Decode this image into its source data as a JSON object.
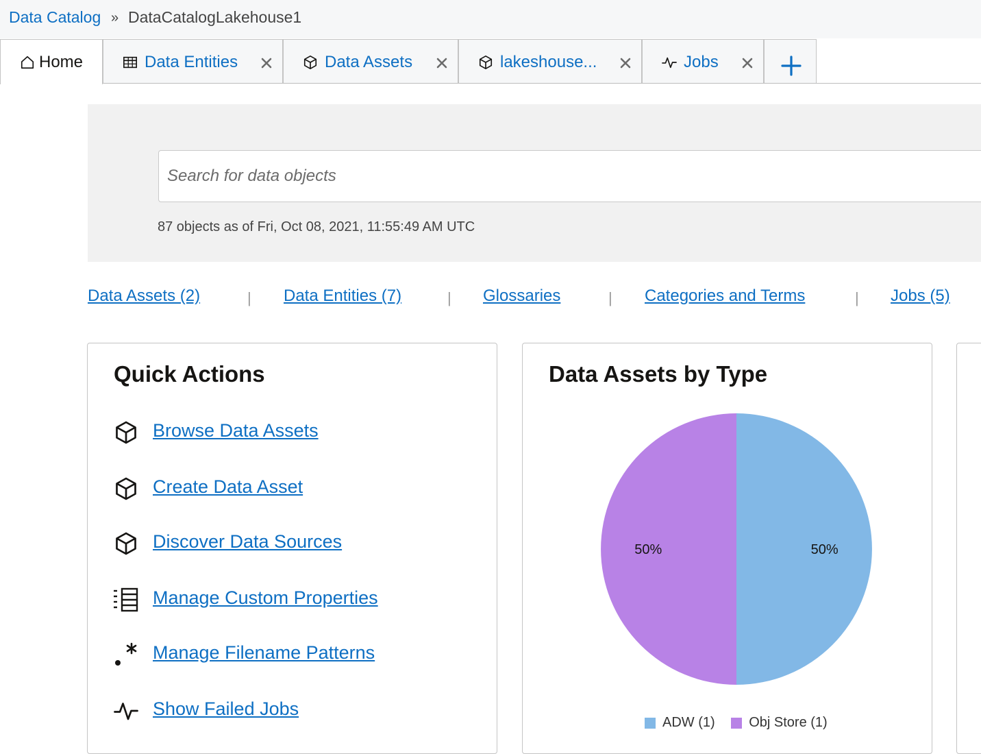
{
  "breadcrumb": {
    "root": "Data Catalog",
    "separator": "»",
    "current": "DataCatalogLakehouse1"
  },
  "tabs": [
    {
      "label": "Home",
      "icon": "home-icon",
      "active": true,
      "closable": false
    },
    {
      "label": "Data Entities",
      "icon": "table-icon",
      "active": false,
      "closable": true
    },
    {
      "label": "Data Assets",
      "icon": "cube-icon",
      "active": false,
      "closable": true
    },
    {
      "label": "lakeshouse...",
      "icon": "cube-icon",
      "active": false,
      "closable": true
    },
    {
      "label": "Jobs",
      "icon": "activity-icon",
      "active": false,
      "closable": true
    }
  ],
  "add_tab": {
    "icon": "plus-icon"
  },
  "search": {
    "placeholder": "Search for data objects",
    "value": "",
    "count_text": "87 objects as of Fri, Oct 08, 2021, 11:55:49 AM UTC"
  },
  "quick_links": [
    {
      "label": "Data Assets (2)"
    },
    {
      "label": "Data Entities (7)"
    },
    {
      "label": "Glossaries"
    },
    {
      "label": "Categories and Terms"
    },
    {
      "label": "Jobs (5)"
    }
  ],
  "quick_actions": {
    "title": "Quick Actions",
    "items": [
      {
        "label": "Browse Data Assets",
        "icon": "cube-icon"
      },
      {
        "label": "Create Data Asset",
        "icon": "cube-icon"
      },
      {
        "label": "Discover Data Sources",
        "icon": "cube-icon"
      },
      {
        "label": "Manage Custom Properties",
        "icon": "list-icon"
      },
      {
        "label": "Manage Filename Patterns",
        "icon": "regex-icon"
      },
      {
        "label": "Show Failed Jobs",
        "icon": "activity-icon"
      }
    ]
  },
  "assets_card": {
    "title": "Data Assets by Type"
  },
  "colors": {
    "link": "#0e6fc3",
    "adw": "#82b8e6",
    "obj_store": "#b882e6"
  },
  "chart_data": {
    "type": "pie",
    "title": "Data Assets by Type",
    "slices": [
      {
        "label": "ADW (1)",
        "value": 1,
        "percent_label": "50%",
        "color": "#82b8e6"
      },
      {
        "label": "Obj Store (1)",
        "value": 1,
        "percent_label": "50%",
        "color": "#b882e6"
      }
    ],
    "legend": "bottom"
  }
}
